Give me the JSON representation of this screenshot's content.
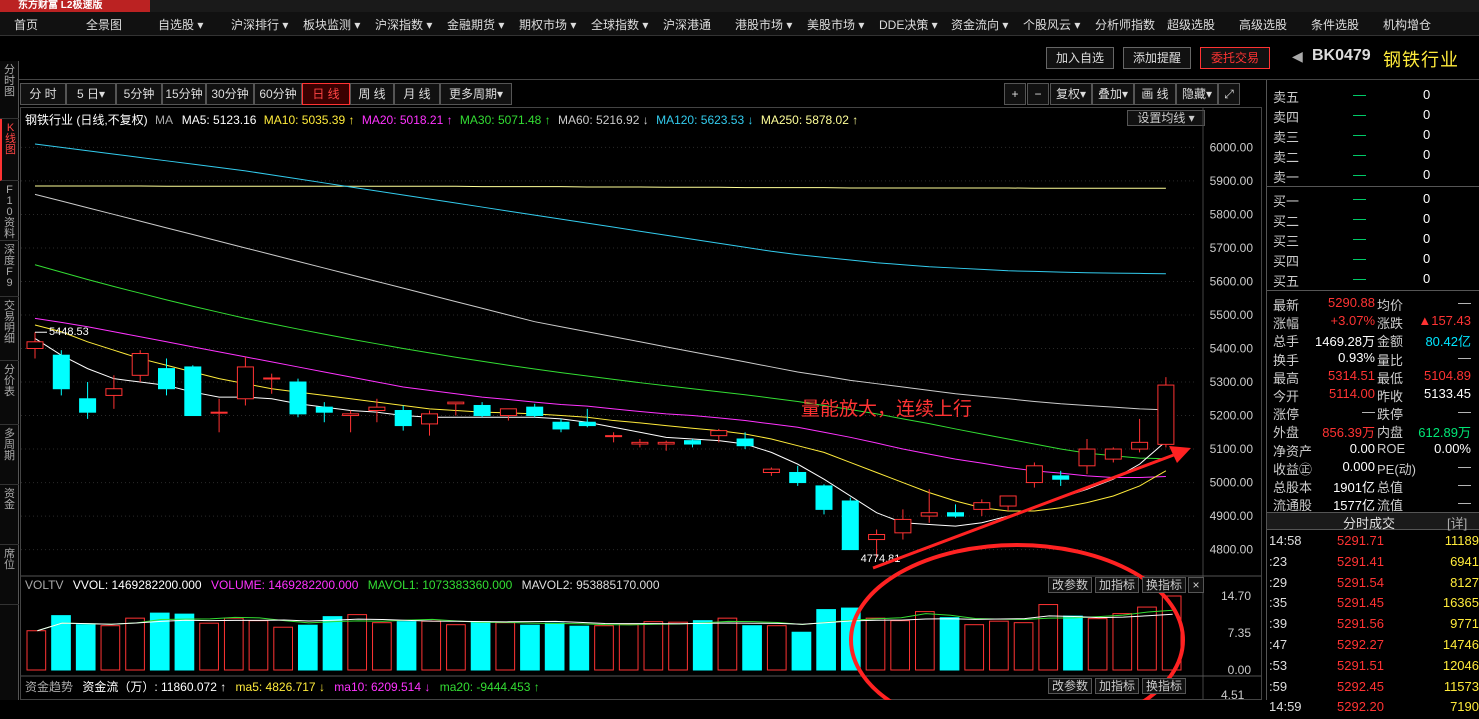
{
  "app": {
    "logo": "东方财富 L2极速版"
  },
  "nav": [
    "首页",
    "全景图",
    "自选股 ▾",
    "沪深排行 ▾",
    "板块监测 ▾",
    "沪深指数 ▾",
    "金融期货 ▾",
    "期权市场 ▾",
    "全球指数 ▾",
    "沪深港通",
    "港股市场 ▾",
    "美股市场 ▾",
    "DDE决策 ▾",
    "资金流向 ▾",
    "个股风云 ▾",
    "分析师指数",
    "超级选股",
    "高级选股",
    "条件选股",
    "机构增仓"
  ],
  "header": {
    "add_watch": "加入自选",
    "add_alert": "添加提醒",
    "order": "委托交易",
    "code": "BK0479",
    "name": "钢铁行业",
    "arrow": "◀"
  },
  "leftbar": [
    "分时图",
    "K线图",
    "F10资料",
    "深度F9",
    "交易明细",
    "分价表",
    "多周期",
    "资金",
    "席位"
  ],
  "periods": [
    "分 时",
    "5 日▾",
    "5分钟",
    "15分钟",
    "30分钟",
    "60分钟",
    "日 线",
    "周 线",
    "月 线",
    "更多周期▾"
  ],
  "tools": [
    "+",
    "−",
    "复权▾",
    "叠加▾",
    "画 线",
    "隐藏▾",
    "⤢"
  ],
  "ma_legend": {
    "title": "钢铁行业 (日线,不复权)",
    "ma_label": "MA",
    "ma5": "MA5: 5123.16",
    "ma10": "MA10: 5035.39 ↑",
    "ma20": "MA20: 5018.21 ↑",
    "ma30": "MA30: 5071.48 ↑",
    "ma60": "MA60: 5216.92 ↓",
    "ma120": "MA120: 5623.53 ↓",
    "ma250": "MA250: 5878.02 ↑",
    "settings": "设置均线 ▾"
  },
  "price_axis": [
    "6000.00",
    "5900.00",
    "5800.00",
    "5700.00",
    "5600.00",
    "5500.00",
    "5400.00",
    "5300.00",
    "5200.00",
    "5100.00",
    "5000.00",
    "4900.00",
    "4800.00"
  ],
  "annotations": {
    "high_label": "5448.53",
    "low_label": "4774.81",
    "text": "量能放大，连续上行"
  },
  "vol_legend": {
    "name": "VOLTV",
    "vvol": "VVOL: 1469282200.000",
    "volume": "VOLUME: 1469282200.000",
    "mavol1": "MAVOL1: 1073383360.000",
    "mavol2": "MAVOL2: 953885170.000",
    "btn1": "改参数",
    "btn2": "加指标",
    "btn3": "换指标",
    "close": "×"
  },
  "vol_axis": [
    "14.70",
    "7.35",
    "0.00"
  ],
  "fund_legend": {
    "name": "资金趋势",
    "flow": "资金流（万）: 11860.072 ↑",
    "ma5": "ma5: 4826.717 ↓",
    "ma10": "ma10: 6209.514 ↓",
    "ma20": "ma20: -9444.453 ↑",
    "btn1": "改参数",
    "btn2": "加指标",
    "btn3": "换指标",
    "axis": "4.51"
  },
  "orderbook": {
    "sells": [
      {
        "l": "卖五",
        "v": "0"
      },
      {
        "l": "卖四",
        "v": "0"
      },
      {
        "l": "卖三",
        "v": "0"
      },
      {
        "l": "卖二",
        "v": "0"
      },
      {
        "l": "卖一",
        "v": "0"
      }
    ],
    "buys": [
      {
        "l": "买一",
        "v": "0"
      },
      {
        "l": "买二",
        "v": "0"
      },
      {
        "l": "买三",
        "v": "0"
      },
      {
        "l": "买四",
        "v": "0"
      },
      {
        "l": "买五",
        "v": "0"
      }
    ],
    "dash": "—"
  },
  "stats": [
    {
      "l1": "最新",
      "v1": "5290.88",
      "c1": "#ff3333",
      "l2": "均价",
      "v2": "—",
      "c2": "#ccc"
    },
    {
      "l1": "涨幅",
      "v1": "+3.07%",
      "c1": "#ff3333",
      "l2": "涨跌",
      "v2": "▲157.43",
      "c2": "#ff3333"
    },
    {
      "l1": "总手",
      "v1": "1469.28万",
      "c1": "#fff",
      "l2": "金额",
      "v2": "80.42亿",
      "c2": "#00e5ff"
    },
    {
      "l1": "换手",
      "v1": "0.93%",
      "c1": "#fff",
      "l2": "量比",
      "v2": "—",
      "c2": "#ccc"
    },
    {
      "l1": "最高",
      "v1": "5314.51",
      "c1": "#ff3333",
      "l2": "最低",
      "v2": "5104.89",
      "c2": "#ff3333"
    },
    {
      "l1": "今开",
      "v1": "5114.00",
      "c1": "#ff3333",
      "l2": "昨收",
      "v2": "5133.45",
      "c2": "#fff"
    },
    {
      "l1": "涨停",
      "v1": "—",
      "c1": "#ccc",
      "l2": "跌停",
      "v2": "—",
      "c2": "#ccc"
    },
    {
      "l1": "外盘",
      "v1": "856.39万",
      "c1": "#ff3333",
      "l2": "内盘",
      "v2": "612.89万",
      "c2": "#00e676"
    },
    {
      "l1": "净资产",
      "v1": "0.00",
      "c1": "#fff",
      "l2": "ROE",
      "v2": "0.00%",
      "c2": "#fff"
    },
    {
      "l1": "收益㊣",
      "v1": "0.000",
      "c1": "#fff",
      "l2": "PE(动)",
      "v2": "—",
      "c2": "#ccc"
    },
    {
      "l1": "总股本",
      "v1": "1901亿",
      "c1": "#fff",
      "l2": "总值",
      "v2": "—",
      "c2": "#ccc"
    },
    {
      "l1": "流通股",
      "v1": "1577亿",
      "c1": "#fff",
      "l2": "流值",
      "v2": "—",
      "c2": "#ccc"
    }
  ],
  "ticks_header": {
    "title": "分时成交",
    "detail": "[详]"
  },
  "ticks": [
    {
      "t": "14:58",
      "p": "5291.71",
      "v": "11189"
    },
    {
      "t": ":23",
      "p": "5291.41",
      "v": "6941"
    },
    {
      "t": ":29",
      "p": "5291.54",
      "v": "8127"
    },
    {
      "t": ":35",
      "p": "5291.45",
      "v": "16365"
    },
    {
      "t": ":39",
      "p": "5291.56",
      "v": "9771"
    },
    {
      "t": ":47",
      "p": "5292.27",
      "v": "14746"
    },
    {
      "t": ":53",
      "p": "5291.51",
      "v": "12046"
    },
    {
      "t": ":59",
      "p": "5292.45",
      "v": "11573"
    },
    {
      "t": "14:59",
      "p": "5292.20",
      "v": "7190"
    }
  ],
  "chart_data": {
    "type": "candlestick",
    "ylim": [
      4760,
      6040
    ],
    "candles": [
      {
        "o": 5400,
        "h": 5448.53,
        "l": 5370,
        "c": 5420
      },
      {
        "o": 5380,
        "h": 5395,
        "l": 5260,
        "c": 5280
      },
      {
        "o": 5250,
        "h": 5300,
        "l": 5190,
        "c": 5210
      },
      {
        "o": 5260,
        "h": 5320,
        "l": 5220,
        "c": 5280
      },
      {
        "o": 5320,
        "h": 5395,
        "l": 5300,
        "c": 5385
      },
      {
        "o": 5340,
        "h": 5370,
        "l": 5260,
        "c": 5280
      },
      {
        "o": 5345,
        "h": 5350,
        "l": 5210,
        "c": 5200
      },
      {
        "o": 5210,
        "h": 5250,
        "l": 5150,
        "c": 5210
      },
      {
        "o": 5250,
        "h": 5375,
        "l": 5230,
        "c": 5345
      },
      {
        "o": 5310,
        "h": 5325,
        "l": 5265,
        "c": 5312
      },
      {
        "o": 5300,
        "h": 5310,
        "l": 5195,
        "c": 5205
      },
      {
        "o": 5225,
        "h": 5240,
        "l": 5180,
        "c": 5210
      },
      {
        "o": 5200,
        "h": 5215,
        "l": 5150,
        "c": 5205
      },
      {
        "o": 5215,
        "h": 5250,
        "l": 5180,
        "c": 5225
      },
      {
        "o": 5215,
        "h": 5230,
        "l": 5155,
        "c": 5170
      },
      {
        "o": 5175,
        "h": 5215,
        "l": 5140,
        "c": 5205
      },
      {
        "o": 5235,
        "h": 5240,
        "l": 5200,
        "c": 5240
      },
      {
        "o": 5230,
        "h": 5240,
        "l": 5195,
        "c": 5200
      },
      {
        "o": 5200,
        "h": 5215,
        "l": 5185,
        "c": 5220
      },
      {
        "o": 5225,
        "h": 5235,
        "l": 5195,
        "c": 5200
      },
      {
        "o": 5180,
        "h": 5190,
        "l": 5150,
        "c": 5160
      },
      {
        "o": 5180,
        "h": 5220,
        "l": 5165,
        "c": 5170
      },
      {
        "o": 5140,
        "h": 5150,
        "l": 5120,
        "c": 5140
      },
      {
        "o": 5115,
        "h": 5130,
        "l": 5105,
        "c": 5120
      },
      {
        "o": 5115,
        "h": 5125,
        "l": 5095,
        "c": 5120
      },
      {
        "o": 5125,
        "h": 5130,
        "l": 5105,
        "c": 5115
      },
      {
        "o": 5140,
        "h": 5160,
        "l": 5120,
        "c": 5155
      },
      {
        "o": 5130,
        "h": 5150,
        "l": 5100,
        "c": 5110
      },
      {
        "o": 5030,
        "h": 5045,
        "l": 5020,
        "c": 5040
      },
      {
        "o": 5030,
        "h": 5050,
        "l": 4990,
        "c": 5000
      },
      {
        "o": 4990,
        "h": 4995,
        "l": 4905,
        "c": 4920
      },
      {
        "o": 4945,
        "h": 4955,
        "l": 4805,
        "c": 4800
      },
      {
        "o": 4830,
        "h": 4860,
        "l": 4774.81,
        "c": 4845
      },
      {
        "o": 4850,
        "h": 4920,
        "l": 4830,
        "c": 4890
      },
      {
        "o": 4900,
        "h": 4980,
        "l": 4880,
        "c": 4910
      },
      {
        "o": 4910,
        "h": 4935,
        "l": 4895,
        "c": 4900
      },
      {
        "o": 4920,
        "h": 4950,
        "l": 4900,
        "c": 4940
      },
      {
        "o": 4930,
        "h": 4960,
        "l": 4915,
        "c": 4960
      },
      {
        "o": 5000,
        "h": 5060,
        "l": 4985,
        "c": 5050
      },
      {
        "o": 5020,
        "h": 5035,
        "l": 4990,
        "c": 5010
      },
      {
        "o": 5050,
        "h": 5130,
        "l": 5025,
        "c": 5100
      },
      {
        "o": 5070,
        "h": 5105,
        "l": 5060,
        "c": 5100
      },
      {
        "o": 5100,
        "h": 5190,
        "l": 5090,
        "c": 5120
      },
      {
        "o": 5114,
        "h": 5314.51,
        "l": 5104.89,
        "c": 5290.88
      }
    ],
    "ma5": [
      5430,
      5380,
      5340,
      5310,
      5300,
      5290,
      5270,
      5255,
      5255,
      5250,
      5235,
      5225,
      5215,
      5210,
      5200,
      5195,
      5195,
      5195,
      5195,
      5195,
      5190,
      5180,
      5165,
      5150,
      5135,
      5130,
      5125,
      5115,
      5090,
      5055,
      5010,
      4960,
      4910,
      4880,
      4875,
      4870,
      4880,
      4900,
      4925,
      4955,
      4980,
      5010,
      5055,
      5123
    ],
    "ma10": [
      5470,
      5450,
      5420,
      5395,
      5370,
      5350,
      5330,
      5310,
      5295,
      5280,
      5270,
      5260,
      5250,
      5240,
      5230,
      5220,
      5215,
      5210,
      5208,
      5205,
      5200,
      5195,
      5185,
      5178,
      5170,
      5162,
      5155,
      5145,
      5130,
      5110,
      5090,
      5060,
      5030,
      5000,
      4970,
      4945,
      4925,
      4915,
      4915,
      4925,
      4940,
      4960,
      4990,
      5035
    ],
    "ma20": [
      5490,
      5478,
      5465,
      5450,
      5435,
      5420,
      5405,
      5390,
      5375,
      5360,
      5345,
      5330,
      5315,
      5300,
      5285,
      5275,
      5265,
      5255,
      5248,
      5240,
      5233,
      5228,
      5220,
      5212,
      5205,
      5200,
      5193,
      5185,
      5175,
      5165,
      5150,
      5135,
      5118,
      5100,
      5085,
      5070,
      5058,
      5045,
      5035,
      5028,
      5020,
      5015,
      5015,
      5018
    ],
    "ma30": [
      5650,
      5628,
      5606,
      5585,
      5565,
      5545,
      5526,
      5508,
      5490,
      5474,
      5458,
      5443,
      5428,
      5414,
      5400,
      5387,
      5374,
      5362,
      5350,
      5339,
      5328,
      5318,
      5308,
      5298,
      5289,
      5280,
      5271,
      5262,
      5252,
      5242,
      5230,
      5218,
      5205,
      5190,
      5176,
      5160,
      5145,
      5130,
      5115,
      5100,
      5088,
      5080,
      5073,
      5071
    ],
    "ma60": [
      5860,
      5840,
      5820,
      5800,
      5780,
      5760,
      5740,
      5720,
      5700,
      5680,
      5660,
      5640,
      5620,
      5600,
      5580,
      5560,
      5540,
      5520,
      5500,
      5480,
      5465,
      5450,
      5435,
      5420,
      5405,
      5390,
      5375,
      5360,
      5345,
      5330,
      5318,
      5305,
      5295,
      5285,
      5275,
      5265,
      5257,
      5250,
      5242,
      5235,
      5230,
      5225,
      5220,
      5217
    ],
    "ma120": [
      6010,
      6000,
      5990,
      5980,
      5970,
      5960,
      5950,
      5940,
      5930,
      5918,
      5906,
      5894,
      5882,
      5870,
      5858,
      5846,
      5834,
      5822,
      5810,
      5798,
      5786,
      5774,
      5762,
      5750,
      5738,
      5726,
      5714,
      5702,
      5690,
      5680,
      5672,
      5664,
      5656,
      5650,
      5644,
      5640,
      5636,
      5632,
      5630,
      5628,
      5626,
      5625,
      5624,
      5623
    ],
    "ma250": [
      5885,
      5885,
      5885,
      5885,
      5885,
      5884,
      5884,
      5884,
      5884,
      5884,
      5884,
      5884,
      5884,
      5884,
      5884,
      5884,
      5884,
      5883,
      5883,
      5883,
      5883,
      5882,
      5882,
      5882,
      5881,
      5881,
      5881,
      5880,
      5880,
      5880,
      5880,
      5879,
      5879,
      5879,
      5879,
      5879,
      5879,
      5879,
      5878,
      5878,
      5878,
      5878,
      5878,
      5878
    ],
    "vol_ylim": [
      0,
      14.7
    ],
    "volume": [
      7.8,
      10.8,
      9.0,
      8.8,
      10.3,
      11.3,
      11.1,
      9.3,
      10.3,
      9.8,
      8.5,
      8.9,
      10.6,
      11.0,
      9.4,
      9.6,
      9.7,
      9.0,
      9.6,
      9.4,
      8.9,
      9.3,
      8.7,
      8.8,
      9.1,
      9.6,
      9.5,
      9.8,
      10.3,
      8.8,
      8.8,
      7.5,
      12.0,
      12.3,
      10.3,
      9.8,
      11.6,
      10.4,
      9.0,
      9.7,
      9.4,
      13.0,
      10.7,
      10.2,
      11.2,
      12.5,
      14.7
    ]
  }
}
